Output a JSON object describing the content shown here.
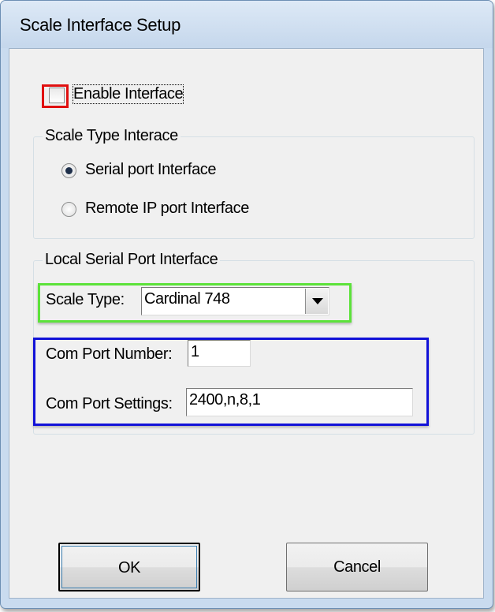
{
  "window": {
    "title": "Scale Interface Setup"
  },
  "enable_interface": {
    "label": "Enable Interface",
    "checked": false
  },
  "scale_type_group": {
    "legend": "Scale Type Interace",
    "options": [
      {
        "label": "Serial port Interface",
        "selected": true
      },
      {
        "label": "Remote IP port Interface",
        "selected": false
      }
    ]
  },
  "local_serial_group": {
    "legend": "Local Serial Port Interface",
    "scale_type": {
      "label": "Scale Type:",
      "value": "Cardinal 748"
    },
    "com_port_number": {
      "label": "Com Port Number:",
      "value": "1"
    },
    "com_port_settings": {
      "label": "Com Port Settings:",
      "value": "2400,n,8,1"
    }
  },
  "buttons": {
    "ok": "OK",
    "cancel": "Cancel"
  },
  "annotations": {
    "red": "#e01010",
    "green": "#5ce23a",
    "blue": "#1212d8"
  }
}
